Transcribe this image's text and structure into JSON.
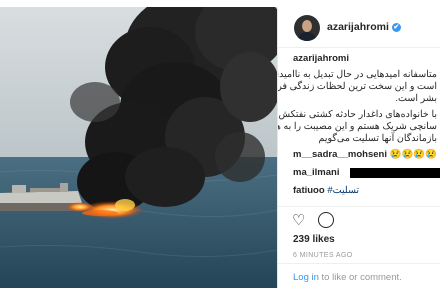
{
  "header": {
    "username": "azarijahromi",
    "verified_mark": "✔"
  },
  "caption": {
    "username": "azarijahromi",
    "lines": [
      "متاسفانه امیدهایی در حال تبدیل به ناامیدی",
      "است و این سخت ترین لحظات زندگی فردی",
      "بشر است.",
      "با خانواده‌های داغدار حادثه کشتی نفتکش",
      "سانچی شریک هستم و این مصیبت را به همه",
      "بازماندگان آنها تسلیت می‌گویم"
    ]
  },
  "comments": [
    {
      "user": "m__sadra__mohseni",
      "text": "😢😢😢😢"
    },
    {
      "user": "ma_ilmani",
      "text": ""
    },
    {
      "user": "fatiuoo",
      "text": "#تسلیت"
    },
    {
      "user": "",
      "text": "..."
    }
  ],
  "likes": "239 likes",
  "time": "6 MINUTES AGO",
  "footer": {
    "login": "Log in",
    "rest": " to like or comment."
  },
  "icons": {
    "like": "heart-outline-icon",
    "comment": "comment-bubble-icon"
  }
}
